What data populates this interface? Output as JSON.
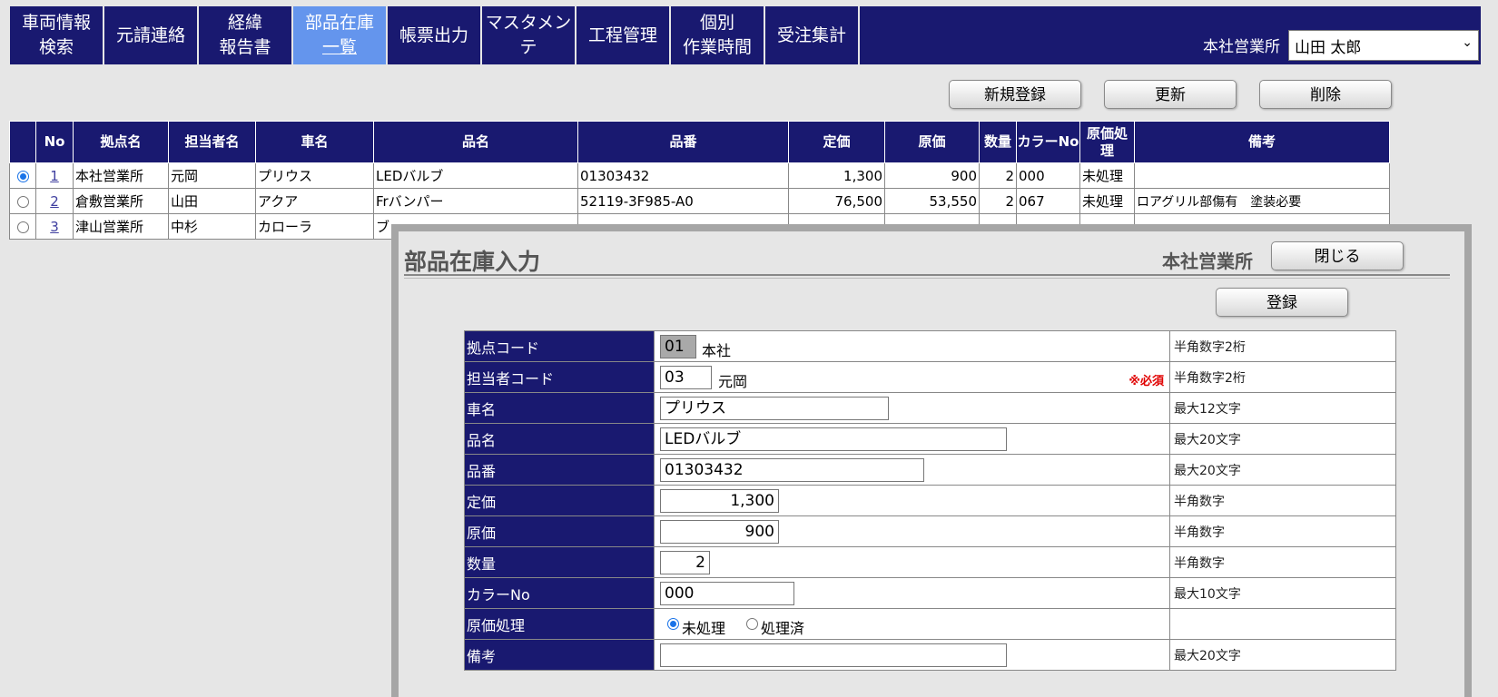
{
  "nav": {
    "items": [
      {
        "line1": "車両情報",
        "line2": "検索",
        "active": false
      },
      {
        "line1": "元請連絡",
        "line2": "",
        "active": false
      },
      {
        "line1": "経緯",
        "line2": "報告書",
        "active": false
      },
      {
        "line1": "部品在庫",
        "line2": "一覧",
        "active": true
      },
      {
        "line1": "帳票出力",
        "line2": "",
        "active": false
      },
      {
        "line1": "マスタメンテ",
        "line2": "",
        "active": false
      },
      {
        "line1": "工程管理",
        "line2": "",
        "active": false
      },
      {
        "line1": "個別",
        "line2": "作業時間",
        "active": false
      },
      {
        "line1": "受注集計",
        "line2": "",
        "active": false
      }
    ],
    "office_label": "本社営業所",
    "user_selected": "山田 太郎"
  },
  "actions": {
    "new_label": "新規登録",
    "update_label": "更新",
    "delete_label": "削除"
  },
  "table": {
    "headers": [
      "",
      "No",
      "拠点名",
      "担当者名",
      "車名",
      "品名",
      "品番",
      "定価",
      "原価",
      "数量",
      "カラーNo",
      "原価処理",
      "備考"
    ],
    "rows": [
      {
        "selected": true,
        "no": "1",
        "office": "本社営業所",
        "person": "元岡",
        "car": "プリウス",
        "part": "LEDバルブ",
        "part_no": "01303432",
        "list_price": "1,300",
        "cost": "900",
        "qty": "2",
        "color": "000",
        "cost_proc": "未処理",
        "note": ""
      },
      {
        "selected": false,
        "no": "2",
        "office": "倉敷営業所",
        "person": "山田",
        "car": "アクア",
        "part": "Frバンパー",
        "part_no": "52119-3F985-A0",
        "list_price": "76,500",
        "cost": "53,550",
        "qty": "2",
        "color": "067",
        "cost_proc": "未処理",
        "note": "ロアグリル部傷有　塗装必要"
      },
      {
        "selected": false,
        "no": "3",
        "office": "津山営業所",
        "person": "中杉",
        "car": "カローラ",
        "part": "ブ",
        "part_no": "",
        "list_price": "",
        "cost": "",
        "qty": "",
        "color": "",
        "cost_proc": "",
        "note": ""
      }
    ]
  },
  "modal": {
    "title": "部品在庫入力",
    "office": "本社営業所",
    "close_label": "閉じる",
    "register_label": "登録",
    "fields": {
      "base_code": {
        "label": "拠点コード",
        "value": "01",
        "after": "本社",
        "hint": "半角数字2桁"
      },
      "person_code": {
        "label": "担当者コード",
        "value": "03",
        "after": "元岡",
        "required": "※必須",
        "hint": "半角数字2桁"
      },
      "car_name": {
        "label": "車名",
        "value": "プリウス",
        "hint": "最大12文字"
      },
      "part_name": {
        "label": "品名",
        "value": "LEDバルブ",
        "hint": "最大20文字"
      },
      "part_no": {
        "label": "品番",
        "value": "01303432",
        "hint": "最大20文字"
      },
      "list_price": {
        "label": "定価",
        "value": "1,300",
        "hint": "半角数字"
      },
      "cost": {
        "label": "原価",
        "value": "900",
        "hint": "半角数字"
      },
      "qty": {
        "label": "数量",
        "value": "2",
        "hint": "半角数字"
      },
      "color_no": {
        "label": "カラーNo",
        "value": "000",
        "hint": "最大10文字"
      },
      "cost_proc": {
        "label": "原価処理",
        "opt1": "未処理",
        "opt2": "処理済",
        "selected": "未処理"
      },
      "note": {
        "label": "備考",
        "value": "",
        "hint": "最大20文字"
      }
    }
  },
  "colors": {
    "navy": "#191970",
    "active_tab": "#6495ed",
    "required": "#e00000"
  }
}
